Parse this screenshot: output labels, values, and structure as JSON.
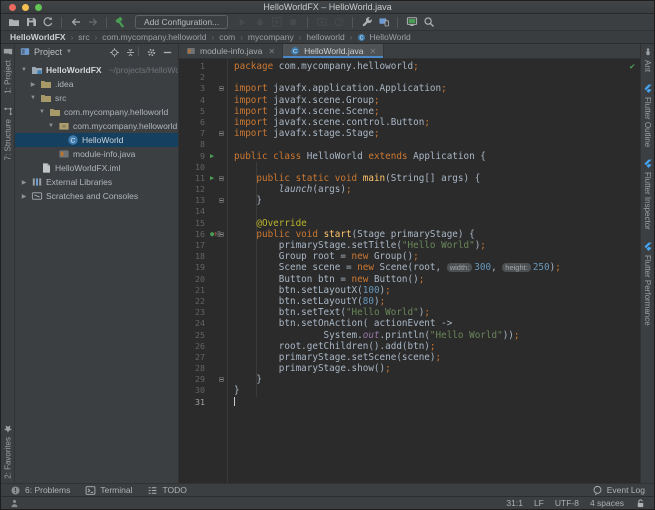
{
  "window": {
    "title": "HelloWorldFX – HelloWorld.java"
  },
  "colors": {
    "keyword": "#CC7832",
    "string": "#6A8759",
    "number": "#6897BB",
    "text": "#A9B7C6",
    "annotation": "#BBB529",
    "method_decl": "#FFC66D",
    "run_green": "#499C54",
    "tab_underline": "#4A88C7",
    "selection": "#16405F",
    "editor_bg": "#2B2B2B",
    "panel_bg": "#3C3F41"
  },
  "toolbar": {
    "add_configuration_label": "Add Configuration...",
    "items": [
      {
        "kind": "open",
        "name": "open-project-icon",
        "state": "normal"
      },
      {
        "kind": "save",
        "name": "save-all-icon",
        "state": "normal"
      },
      {
        "kind": "sync",
        "name": "synchronize-icon",
        "state": "normal"
      },
      {
        "kind": "sep"
      },
      {
        "kind": "back",
        "name": "navigate-back-icon",
        "state": "normal"
      },
      {
        "kind": "forward",
        "name": "navigate-forward-icon",
        "state": "disabled"
      },
      {
        "kind": "sep"
      },
      {
        "kind": "hammer",
        "name": "build-hammer-icon",
        "state": "normal"
      },
      {
        "kind": "addconf",
        "name": "add-configuration-button"
      },
      {
        "kind": "play",
        "name": "run-icon",
        "state": "disabled"
      },
      {
        "kind": "bug",
        "name": "debug-icon",
        "state": "disabled"
      },
      {
        "kind": "coverage",
        "name": "run-with-coverage-icon",
        "state": "disabled"
      },
      {
        "kind": "stop",
        "name": "stop-icon",
        "state": "disabled"
      },
      {
        "kind": "sep"
      },
      {
        "kind": "attach",
        "name": "attach-debugger-icon",
        "state": "disabled"
      },
      {
        "kind": "profiler",
        "name": "profiler-icon",
        "state": "disabled"
      },
      {
        "kind": "sep"
      },
      {
        "kind": "wrench",
        "name": "sdk-manager-wrench-icon",
        "state": "normal"
      },
      {
        "kind": "devices",
        "name": "device-manager-icon",
        "state": "normal"
      },
      {
        "kind": "sep"
      },
      {
        "kind": "monitor",
        "name": "emulator-monitor-icon",
        "state": "normal"
      },
      {
        "kind": "search",
        "name": "search-everywhere-icon",
        "state": "normal"
      }
    ]
  },
  "breadcrumbs": [
    "HelloWorldFX",
    "src",
    "com.mycompany.helloworld",
    "com",
    "mycompany",
    "helloworld",
    "HelloWorld"
  ],
  "left_stripe": {
    "top": [
      {
        "label": "1: Project",
        "icon": "project-tool-icon",
        "kind": "projecttool"
      },
      {
        "label": "7: Structure",
        "icon": "structure-tool-icon",
        "kind": "structure"
      }
    ],
    "bottom": [
      {
        "label": "2: Favorites",
        "icon": "favorites-star-icon",
        "kind": "star"
      }
    ]
  },
  "right_stripe": [
    {
      "label": "Ant",
      "icon": "ant-tool-icon",
      "kind": "ant"
    },
    {
      "label": "Flutter Outline",
      "icon": "flutter-icon",
      "kind": "flutter"
    },
    {
      "label": "Flutter Inspector",
      "icon": "flutter-icon",
      "kind": "flutter"
    },
    {
      "label": "Flutter Performance",
      "icon": "flutter-icon",
      "kind": "flutter"
    }
  ],
  "project_panel": {
    "title": "Project",
    "header_icons": [
      {
        "kind": "locate",
        "name": "locate-icon"
      },
      {
        "kind": "collapse",
        "name": "collapse-all-icon"
      },
      {
        "kind": "sepsm"
      },
      {
        "kind": "gear",
        "name": "gear-icon"
      },
      {
        "kind": "hide",
        "name": "hide-panel-icon"
      }
    ],
    "tree": [
      {
        "indent": 0,
        "chevron": "open",
        "icon": "project",
        "label": "HelloWorldFX",
        "hint": "~/projects/HelloWorldFX",
        "bold": true,
        "selected": false
      },
      {
        "indent": 1,
        "chevron": "closed",
        "icon": "folder",
        "label": ".idea",
        "selected": false
      },
      {
        "indent": 1,
        "chevron": "open",
        "icon": "folder",
        "label": "src",
        "selected": false
      },
      {
        "indent": 2,
        "chevron": "open",
        "icon": "folder",
        "label": "com.mycompany.helloworld",
        "selected": false
      },
      {
        "indent": 3,
        "chevron": "open",
        "icon": "package",
        "label": "com.mycompany.helloworld",
        "selected": false
      },
      {
        "indent": 4,
        "chevron": "none",
        "icon": "class",
        "label": "HelloWorld",
        "selected": true
      },
      {
        "indent": 3,
        "chevron": "none",
        "icon": "module",
        "label": "module-info.java",
        "selected": false
      },
      {
        "indent": 1,
        "chevron": "none",
        "icon": "iml",
        "label": "HelloWorldFX.iml",
        "selected": false
      },
      {
        "indent": 0,
        "chevron": "closed",
        "icon": "lib",
        "label": "External Libraries",
        "selected": false
      },
      {
        "indent": 0,
        "chevron": "closed",
        "icon": "scratch",
        "label": "Scratches and Consoles",
        "selected": false
      }
    ]
  },
  "editor": {
    "tabs": [
      {
        "label": "module-info.java",
        "icon": "module",
        "active": false
      },
      {
        "label": "HelloWorld.java",
        "icon": "class",
        "active": true
      }
    ],
    "inspection_ok_glyph": "✔",
    "lines": [
      {
        "g": null,
        "f": false,
        "s": [
          [
            "kw",
            "package"
          ],
          [
            "def",
            " com.mycompany.helloworld"
          ],
          [
            "kw",
            ";"
          ]
        ]
      },
      {
        "s": []
      },
      {
        "f": true,
        "s": [
          [
            "kw",
            "import"
          ],
          [
            "def",
            " javafx.application.Application"
          ],
          [
            "kw",
            ";"
          ]
        ]
      },
      {
        "s": [
          [
            "kw",
            "import"
          ],
          [
            "def",
            " javafx.scene.Group"
          ],
          [
            "kw",
            ";"
          ]
        ]
      },
      {
        "s": [
          [
            "kw",
            "import"
          ],
          [
            "def",
            " javafx.scene.Scene"
          ],
          [
            "kw",
            ";"
          ]
        ]
      },
      {
        "s": [
          [
            "kw",
            "import"
          ],
          [
            "def",
            " javafx.scene.control.Button"
          ],
          [
            "kw",
            ";"
          ]
        ]
      },
      {
        "f": true,
        "s": [
          [
            "kw",
            "import"
          ],
          [
            "def",
            " javafx.stage.Stage"
          ],
          [
            "kw",
            ";"
          ]
        ]
      },
      {
        "s": []
      },
      {
        "g": "run",
        "s": [
          [
            "kw",
            "public class "
          ],
          [
            "def",
            "HelloWorld "
          ],
          [
            "kw",
            "extends"
          ],
          [
            "def",
            " Application {"
          ]
        ]
      },
      {
        "s": []
      },
      {
        "g": "run",
        "f": true,
        "s": [
          [
            "def",
            "    "
          ],
          [
            "kw",
            "public static void "
          ],
          [
            "decl",
            "main"
          ],
          [
            "def",
            "(String[] args) {"
          ]
        ]
      },
      {
        "s": [
          [
            "def",
            "        "
          ],
          [
            "lam",
            "launch"
          ],
          [
            "def",
            "(args)"
          ],
          [
            "kw",
            ";"
          ]
        ]
      },
      {
        "f": true,
        "s": [
          [
            "def",
            "    }"
          ]
        ]
      },
      {
        "s": []
      },
      {
        "s": [
          [
            "def",
            "    "
          ],
          [
            "ann",
            "@Override"
          ]
        ]
      },
      {
        "g": "ovr",
        "f": true,
        "s": [
          [
            "def",
            "    "
          ],
          [
            "kw",
            "public void "
          ],
          [
            "decl",
            "start"
          ],
          [
            "def",
            "(Stage primaryStage) {"
          ]
        ]
      },
      {
        "s": [
          [
            "def",
            "        primaryStage.setTitle("
          ],
          [
            "str",
            "\"Hello World\""
          ],
          [
            "def",
            ")"
          ],
          [
            "kw",
            ";"
          ]
        ]
      },
      {
        "s": [
          [
            "def",
            "        Group root = "
          ],
          [
            "kw",
            "new"
          ],
          [
            "def",
            " Group()"
          ],
          [
            "kw",
            ";"
          ]
        ]
      },
      {
        "s": [
          [
            "def",
            "        Scene scene = "
          ],
          [
            "kw",
            "new"
          ],
          [
            "def",
            " Scene(root, "
          ],
          [
            "hint",
            "width:"
          ],
          [
            "num",
            "300"
          ],
          [
            "def",
            ", "
          ],
          [
            "hint",
            "height:"
          ],
          [
            "num",
            "250"
          ],
          [
            "def",
            ")"
          ],
          [
            "kw",
            ";"
          ]
        ]
      },
      {
        "s": [
          [
            "def",
            "        Button btn = "
          ],
          [
            "kw",
            "new"
          ],
          [
            "def",
            " Button()"
          ],
          [
            "kw",
            ";"
          ]
        ]
      },
      {
        "s": [
          [
            "def",
            "        btn.setLayoutX("
          ],
          [
            "num",
            "100"
          ],
          [
            "def",
            ")"
          ],
          [
            "kw",
            ";"
          ]
        ]
      },
      {
        "s": [
          [
            "def",
            "        btn.setLayoutY("
          ],
          [
            "num",
            "80"
          ],
          [
            "def",
            ")"
          ],
          [
            "kw",
            ";"
          ]
        ]
      },
      {
        "s": [
          [
            "def",
            "        btn.setText("
          ],
          [
            "str",
            "\"Hello World\""
          ],
          [
            "def",
            ")"
          ],
          [
            "kw",
            ";"
          ]
        ]
      },
      {
        "s": [
          [
            "def",
            "        btn.setOnAction( actionEvent ->"
          ]
        ]
      },
      {
        "s": [
          [
            "def",
            "                System."
          ],
          [
            "fld",
            "out"
          ],
          [
            "def",
            ".println("
          ],
          [
            "str",
            "\"Hello World\""
          ],
          [
            "def",
            "))"
          ],
          [
            "kw",
            ";"
          ]
        ]
      },
      {
        "s": [
          [
            "def",
            "        root.getChildren().add(btn)"
          ],
          [
            "kw",
            ";"
          ]
        ]
      },
      {
        "s": [
          [
            "def",
            "        primaryStage.setScene(scene)"
          ],
          [
            "kw",
            ";"
          ]
        ]
      },
      {
        "s": [
          [
            "def",
            "        primaryStage.show()"
          ],
          [
            "kw",
            ";"
          ]
        ]
      },
      {
        "f": true,
        "s": [
          [
            "def",
            "    }"
          ]
        ]
      },
      {
        "s": [
          [
            "def",
            "}"
          ]
        ]
      },
      {
        "caret": true,
        "s": []
      }
    ]
  },
  "bottom_bar": {
    "left": [
      {
        "label": "6: Problems",
        "icon": "problems-icon",
        "kind": "problems"
      },
      {
        "label": "Terminal",
        "icon": "terminal-icon",
        "kind": "terminal"
      },
      {
        "label": "TODO",
        "icon": "todo-icon",
        "kind": "todo"
      }
    ],
    "right": {
      "label": "Event Log",
      "icon": "event-log-icon",
      "kind": "event"
    }
  },
  "status_bar": {
    "position": "31:1",
    "line_ending": "LF",
    "encoding": "UTF-8",
    "indent": "4 spaces"
  }
}
